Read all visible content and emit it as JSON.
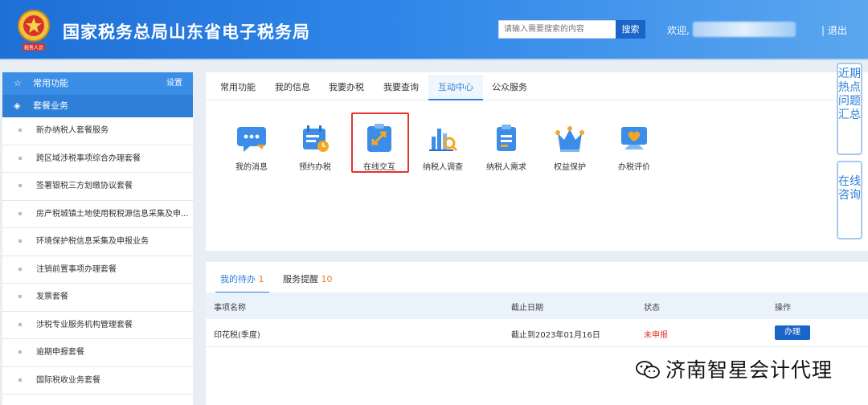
{
  "header": {
    "title": "国家税务总局山东省电子税务局",
    "search_placeholder": "请输入需要搜索的内容",
    "search_button": "搜索",
    "welcome": "欢迎,",
    "logout": "| 退出",
    "emblem_caption": "税务人员"
  },
  "sidebar": {
    "common": "常用功能",
    "settings": "设置",
    "packages": "套餐业务",
    "items": [
      "新办纳税人套餐服务",
      "跨区域涉税事项综合办理套餐",
      "签署银税三方划缴协议套餐",
      "房产税城镇土地使用税税源信息采集及申...",
      "环境保护税信息采集及申报业务",
      "注销前置事项办理套餐",
      "发票套餐",
      "涉税专业服务机构管理套餐",
      "逾期申报套餐",
      "国际税收业务套餐"
    ]
  },
  "tabs": [
    "常用功能",
    "我的信息",
    "我要办税",
    "我要查询",
    "互动中心",
    "公众服务"
  ],
  "active_tab": "互动中心",
  "icons": [
    {
      "label": "我的消息",
      "icon": "message-icon"
    },
    {
      "label": "预约办税",
      "icon": "calendar-icon"
    },
    {
      "label": "在线交互",
      "icon": "online-interaction-icon"
    },
    {
      "label": "纳税人调查",
      "icon": "survey-chart-icon"
    },
    {
      "label": "纳税人需求",
      "icon": "clipboard-icon"
    },
    {
      "label": "权益保护",
      "icon": "crown-icon"
    },
    {
      "label": "办税评价",
      "icon": "rating-heart-icon"
    }
  ],
  "floaters": {
    "hot_topics": "近期热点问题汇总",
    "consult": "在线咨询"
  },
  "todo": {
    "tab_todo": "我的待办",
    "todo_count": "1",
    "tab_remind": "服务提醒",
    "remind_count": "10",
    "columns": [
      "事项名称",
      "截止日期",
      "状态",
      "操作"
    ],
    "rows": [
      {
        "name": "印花税(季度)",
        "deadline": "截止到2023年01月16日",
        "status": "未申报",
        "action": "办理"
      }
    ]
  },
  "watermark": "济南智星会计代理",
  "colors": {
    "header_start": "#1f6fd6",
    "accent": "#2e7fd8",
    "status_red": "#e5332d",
    "count_orange": "#e47b2c"
  }
}
